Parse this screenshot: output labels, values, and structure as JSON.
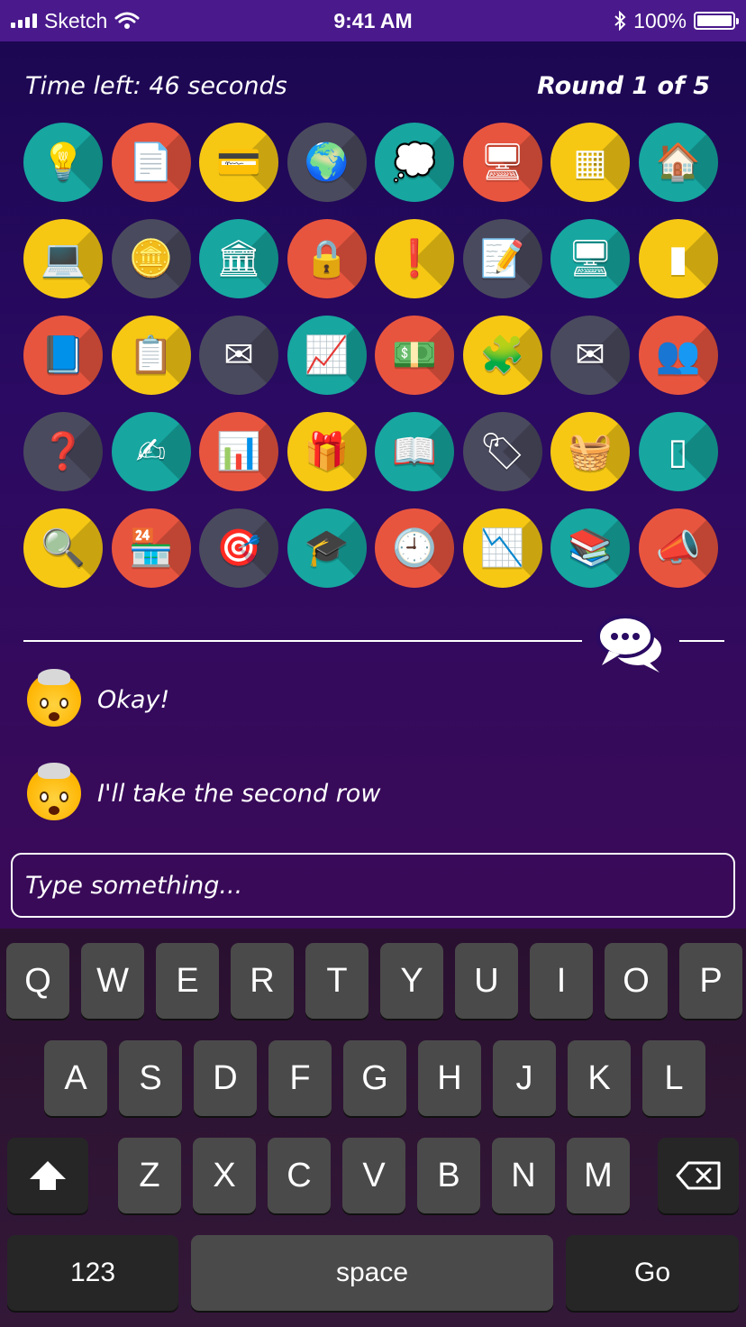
{
  "status_bar": {
    "carrier": "Sketch",
    "time": "9:41 AM",
    "battery": "100%"
  },
  "game": {
    "time_left": "Time left: 46 seconds",
    "round": "Round 1 of 5"
  },
  "tiles": [
    {
      "name": "light-bulb-icon",
      "bg": "#17a6a0",
      "glyph": "💡"
    },
    {
      "name": "document-stamp-icon",
      "bg": "#e8553f",
      "glyph": "📄"
    },
    {
      "name": "credit-card-icon",
      "bg": "#f6c814",
      "glyph": "💳"
    },
    {
      "name": "globe-location-icon",
      "bg": "#4a4a5e",
      "glyph": "🌍"
    },
    {
      "name": "idea-bubble-icon",
      "bg": "#17a6a0",
      "glyph": "💭"
    },
    {
      "name": "marketing-monitor-icon",
      "bg": "#e8553f",
      "glyph": "🖥"
    },
    {
      "name": "safe-icon",
      "bg": "#f6c814",
      "glyph": "▦"
    },
    {
      "name": "house-sale-icon",
      "bg": "#17a6a0",
      "glyph": "🏠"
    },
    {
      "name": "laptop-buy-icon",
      "bg": "#f6c814",
      "glyph": "💻"
    },
    {
      "name": "coin-stacks-icon",
      "bg": "#4a4a5e",
      "glyph": "🪙"
    },
    {
      "name": "bank-icon",
      "bg": "#17a6a0",
      "glyph": "🏛"
    },
    {
      "name": "vault-icon",
      "bg": "#e8553f",
      "glyph": "🔒"
    },
    {
      "name": "chat-alert-icon",
      "bg": "#f6c814",
      "glyph": "❗"
    },
    {
      "name": "idea-paper-icon",
      "bg": "#4a4a5e",
      "glyph": "📝"
    },
    {
      "name": "monitor-offer-icon",
      "bg": "#17a6a0",
      "glyph": "🖥"
    },
    {
      "name": "usb-stick-icon",
      "bg": "#f6c814",
      "glyph": "▮"
    },
    {
      "name": "book-icon",
      "bg": "#e8553f",
      "glyph": "📘"
    },
    {
      "name": "clipboard-icon",
      "bg": "#f6c814",
      "glyph": "📋"
    },
    {
      "name": "mail-letter-icon",
      "bg": "#4a4a5e",
      "glyph": "✉"
    },
    {
      "name": "monitor-chart-icon",
      "bg": "#17a6a0",
      "glyph": "📈"
    },
    {
      "name": "money-bills-icon",
      "bg": "#e8553f",
      "glyph": "💵"
    },
    {
      "name": "puzzle-icon",
      "bg": "#f6c814",
      "glyph": "🧩"
    },
    {
      "name": "envelope-icon",
      "bg": "#4a4a5e",
      "glyph": "✉"
    },
    {
      "name": "network-people-icon",
      "bg": "#e8553f",
      "glyph": "👥"
    },
    {
      "name": "brain-question-icon",
      "bg": "#4a4a5e",
      "glyph": "❓"
    },
    {
      "name": "contract-pen-icon",
      "bg": "#17a6a0",
      "glyph": "✍"
    },
    {
      "name": "chart-board-icon",
      "bg": "#e8553f",
      "glyph": "📊"
    },
    {
      "name": "gift-box-icon",
      "bg": "#f6c814",
      "glyph": "🎁"
    },
    {
      "name": "open-book-icon",
      "bg": "#17a6a0",
      "glyph": "📖"
    },
    {
      "name": "sale-tag-icon",
      "bg": "#4a4a5e",
      "glyph": "🏷"
    },
    {
      "name": "shopping-basket-icon",
      "bg": "#f6c814",
      "glyph": "🧺"
    },
    {
      "name": "tablet-icon",
      "bg": "#17a6a0",
      "glyph": "▯"
    },
    {
      "name": "magnifier-icon",
      "bg": "#f6c814",
      "glyph": "🔍"
    },
    {
      "name": "shop-sale-icon",
      "bg": "#e8553f",
      "glyph": "🏪"
    },
    {
      "name": "target-dart-icon",
      "bg": "#4a4a5e",
      "glyph": "🎯"
    },
    {
      "name": "graduation-cap-icon",
      "bg": "#17a6a0",
      "glyph": "🎓"
    },
    {
      "name": "clock-icon",
      "bg": "#e8553f",
      "glyph": "🕘"
    },
    {
      "name": "presentation-board-icon",
      "bg": "#f6c814",
      "glyph": "📉"
    },
    {
      "name": "book-stack-icon",
      "bg": "#17a6a0",
      "glyph": "📚"
    },
    {
      "name": "megaphone-icon",
      "bg": "#e8553f",
      "glyph": "📣"
    }
  ],
  "chat": {
    "messages": [
      {
        "text": "Okay!"
      },
      {
        "text": "I'll take the second row"
      }
    ],
    "input_placeholder": "Type something..."
  },
  "keyboard": {
    "row1": [
      "Q",
      "W",
      "E",
      "R",
      "T",
      "Y",
      "U",
      "I",
      "O",
      "P"
    ],
    "row2": [
      "A",
      "S",
      "D",
      "F",
      "G",
      "H",
      "J",
      "K",
      "L"
    ],
    "row3": [
      "Z",
      "X",
      "C",
      "V",
      "B",
      "N",
      "M"
    ],
    "numbers_label": "123",
    "space_label": "space",
    "go_label": "Go"
  }
}
